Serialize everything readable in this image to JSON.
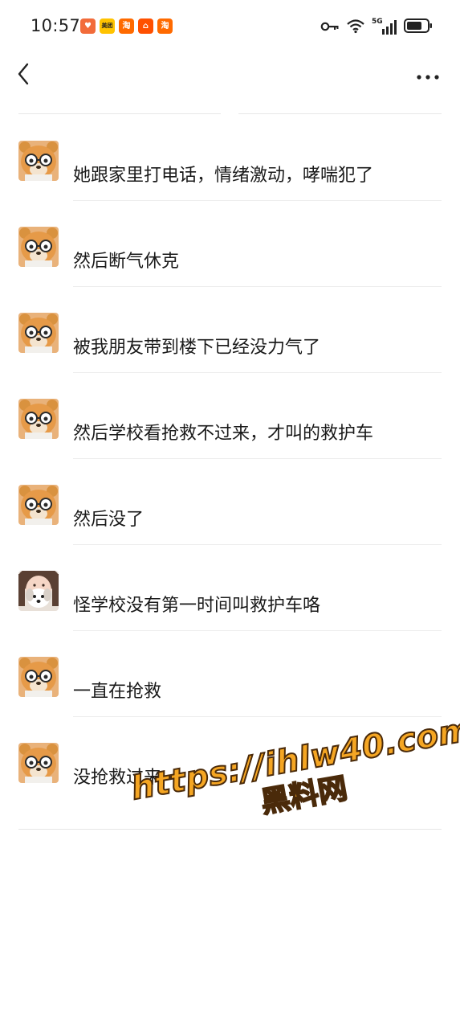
{
  "status_bar": {
    "time": "10:57",
    "apps": [
      {
        "icon": "heart-shield-app-icon",
        "glyph": "♥",
        "color": "#f26b3a"
      },
      {
        "icon": "meituan-app-icon",
        "glyph": "美团",
        "color": "#ffc300"
      },
      {
        "icon": "taobao-app-icon",
        "glyph": "淘",
        "color": "#ff6a00"
      },
      {
        "icon": "location-app-icon",
        "glyph": "⌂",
        "color": "#ff5000"
      },
      {
        "icon": "taobao-app-icon-2",
        "glyph": "淘",
        "color": "#ff6a00"
      }
    ],
    "network": "5G",
    "battery_level": 0.75
  },
  "nav": {
    "back_icon": "chevron-left-icon",
    "more_icon": "more-horizontal-icon"
  },
  "messages": [
    {
      "avatar": "bear-avatar",
      "text": "她跟家里打电话，情绪激动，哮喘犯了"
    },
    {
      "avatar": "bear-avatar",
      "text": "然后断气休克"
    },
    {
      "avatar": "bear-avatar",
      "text": "被我朋友带到楼下已经没力气了"
    },
    {
      "avatar": "bear-avatar",
      "text": "然后学校看抢救不过来，才叫的救护车"
    },
    {
      "avatar": "bear-avatar",
      "text": "然后没了"
    },
    {
      "avatar": "girl-dog-avatar",
      "text": "怪学校没有第一时间叫救护车咯"
    },
    {
      "avatar": "bear-avatar",
      "text": "一直在抢救"
    },
    {
      "avatar": "bear-avatar",
      "text": "没抢救过来"
    }
  ],
  "watermark": {
    "url": "https://ihlw40.com",
    "name": "黑料网"
  },
  "colors": {
    "text": "#1a1a1a",
    "divider": "#ececec",
    "watermark_fill": "#f5a623",
    "watermark_stroke": "#4a2a0a"
  }
}
